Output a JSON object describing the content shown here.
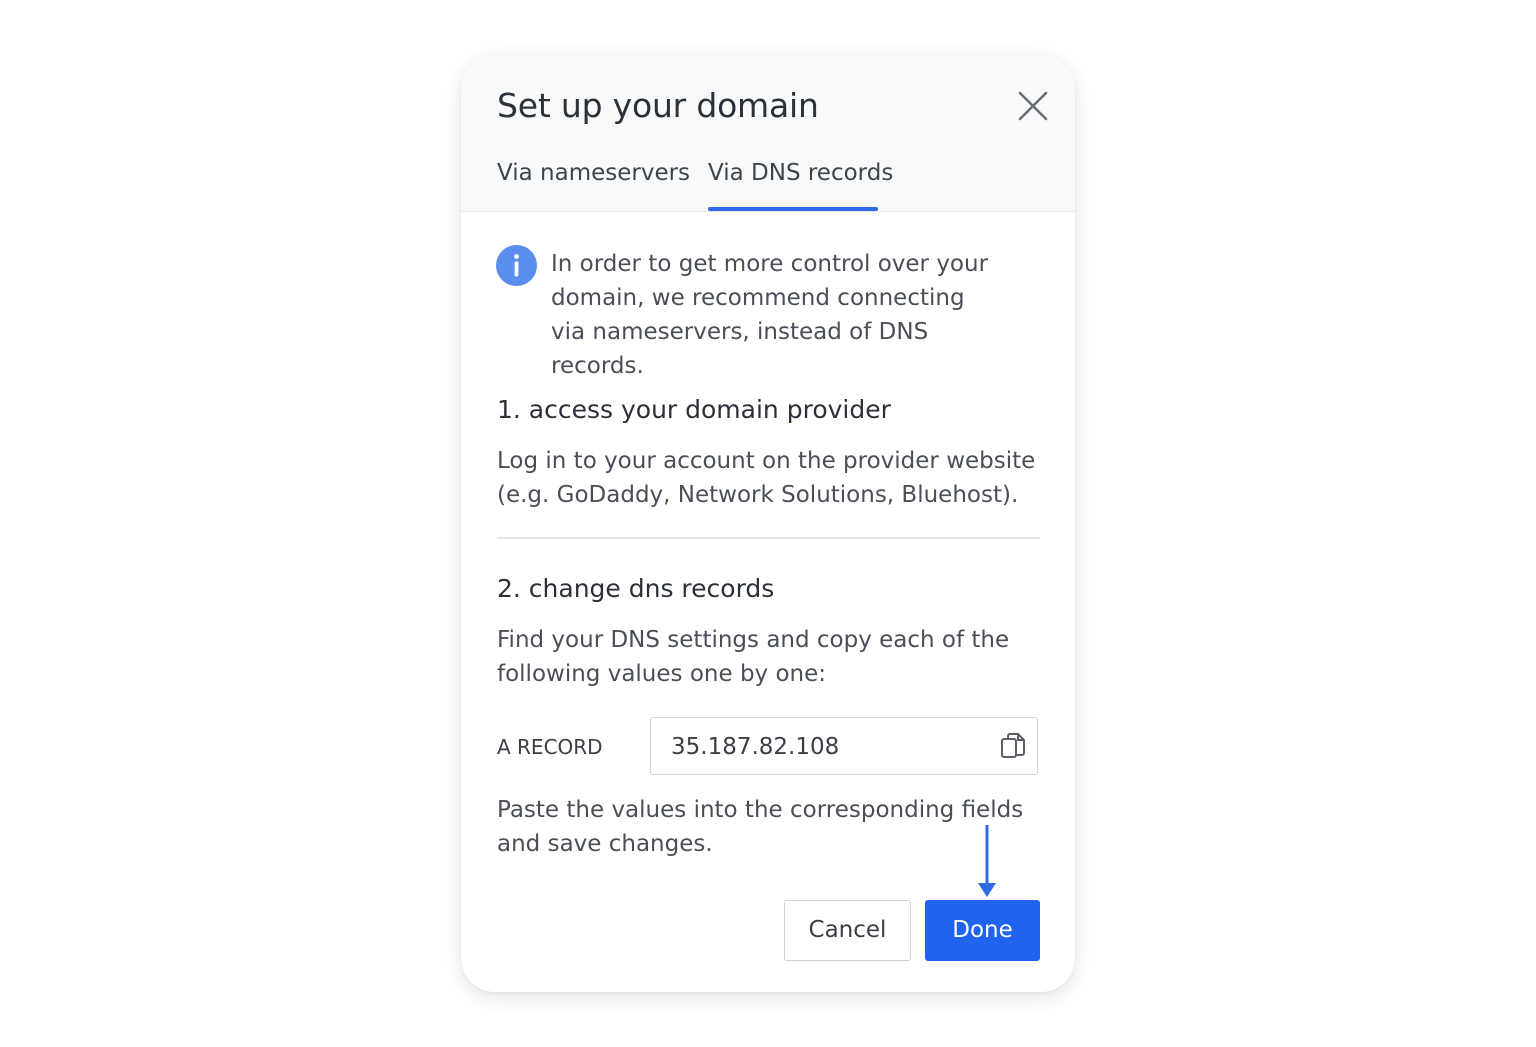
{
  "modal": {
    "title": "Set up your domain",
    "tabs": [
      {
        "label": "Via nameservers",
        "active": false
      },
      {
        "label": "Via DNS records",
        "active": true
      }
    ],
    "info": {
      "text": "In order to get more control over your domain, we recommend connecting via nameservers, instead of DNS records."
    },
    "steps": [
      {
        "title": "1. access your domain provider",
        "text": "Log in to your account on the provider website (e.g. GoDaddy, Network Solutions, Bluehost)."
      },
      {
        "title": "2. change dns records",
        "text": "Find your DNS settings and copy each of the following values one by one:"
      }
    ],
    "record": {
      "label": "A RECORD",
      "value": "35.187.82.108"
    },
    "paste_text": "Paste the values into the corresponding fields and save changes.",
    "buttons": {
      "cancel_label": "Cancel",
      "done_label": "Done"
    }
  },
  "colors": {
    "accent": "#1f63ee",
    "tab_underline": "#2e6ae5",
    "info_icon": "#5b8def",
    "header_bg": "#f8f9fa",
    "text_dark": "#2c3038",
    "text_body": "#4a4f57"
  },
  "icons": {
    "close": "close-icon",
    "info": "info-icon",
    "copy": "copy-icon",
    "arrow": "arrow-down-icon"
  }
}
